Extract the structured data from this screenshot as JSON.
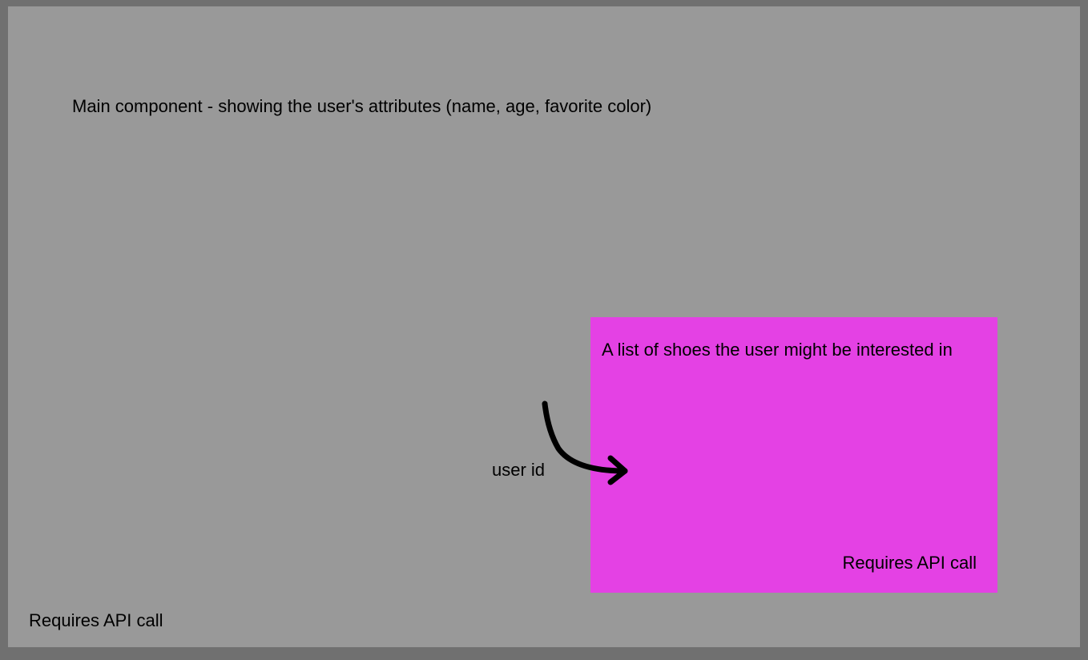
{
  "mainComponent": {
    "title": "Main component - showing the user's attributes (name, age, favorite color)",
    "footer": "Requires API call"
  },
  "childComponent": {
    "title": "A list of shoes the user might be interested in",
    "footer": "Requires API call"
  },
  "arrow": {
    "label": "user id"
  }
}
